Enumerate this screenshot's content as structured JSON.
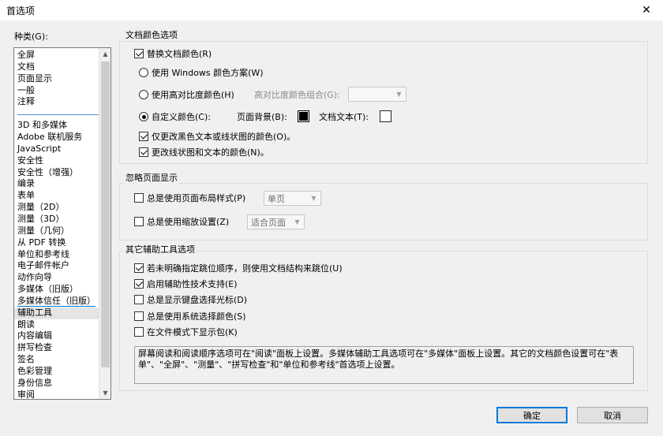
{
  "window": {
    "title": "首选项",
    "close_glyph": "✕"
  },
  "categories": {
    "label": "种类(G):",
    "top_items": [
      "全屏",
      "文档",
      "页面显示",
      "一般",
      "注释"
    ],
    "items": [
      "3D 和多媒体",
      "Adobe 联机服务",
      "JavaScript",
      "安全性",
      "安全性（增强）",
      "编录",
      "表单",
      "测量（2D）",
      "测量（3D）",
      "测量（几何）",
      "从 PDF 转换",
      "单位和参考线",
      "电子邮件帐户",
      "动作向导",
      "多媒体（旧版）",
      "多媒体信任（旧版）",
      "辅助工具",
      "朗读",
      "内容编辑",
      "拼写检查",
      "签名",
      "色彩管理",
      "身份信息",
      "审阅"
    ],
    "selected": "辅助工具"
  },
  "doc_colors": {
    "title": "文档颜色选项",
    "replace_label": "替换文档颜色(R)",
    "replace_checked": true,
    "windows_scheme_label": "使用 Windows 颜色方案(W)",
    "high_contrast_label": "使用高对比度颜色(H)",
    "high_contrast_combo_label": "高对比度颜色组合(G):",
    "high_contrast_combo_value": "",
    "custom_label": "自定义颜色(C):",
    "selected_radio": "custom",
    "page_bg_label": "页面背景(B):",
    "page_bg_color": "#000000",
    "doc_text_label": "文档文本(T):",
    "doc_text_color": "#ffffff",
    "only_black_label": "仅更改黑色文本或线状图的颜色(O)。",
    "only_black_checked": true,
    "change_line_label": "更改线状图和文本的颜色(N)。",
    "change_line_checked": true
  },
  "override": {
    "title": "忽略页面显示",
    "layout_label": "总是使用页面布局样式(P)",
    "layout_checked": false,
    "layout_value": "单页",
    "zoom_label": "总是使用缩放设置(Z)",
    "zoom_checked": false,
    "zoom_value": "适合页面"
  },
  "other": {
    "title": "其它辅助工具选项",
    "items": [
      {
        "label": "若未明确指定跳位顺序，则使用文档结构来跳位(U)",
        "checked": true
      },
      {
        "label": "启用辅助性技术支持(E)",
        "checked": true
      },
      {
        "label": "总是显示键盘选择光标(D)",
        "checked": false
      },
      {
        "label": "总是使用系统选择颜色(S)",
        "checked": false
      },
      {
        "label": "在文件模式下显示包(K)",
        "checked": false
      }
    ],
    "info_text": "屏幕阅读和阅读顺序选项可在\"阅读\"面板上设置。多媒体辅助工具选项可在\"多媒体\"面板上设置。其它的文档颜色设置可在\"表单\"、\"全屏\"、\"测量\"、\"拼写检查\"和\"单位和参考线\"首选项上设置。"
  },
  "buttons": {
    "ok": "确定",
    "cancel": "取消"
  }
}
